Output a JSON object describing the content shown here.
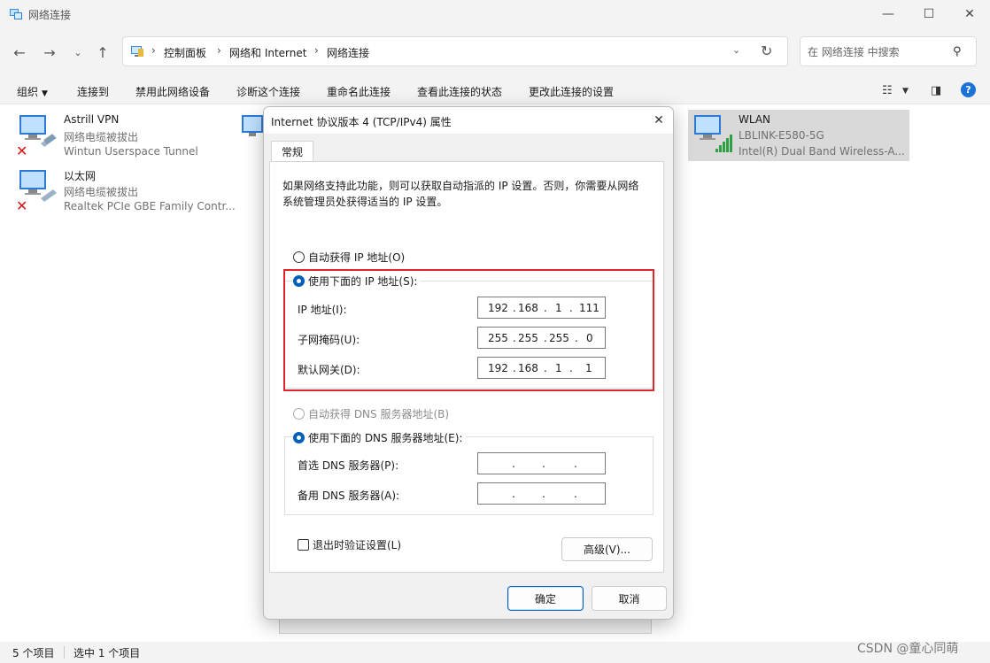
{
  "window": {
    "title": "网络连接",
    "controls": {
      "minimize": "—",
      "maximize": "☐",
      "close": "✕"
    }
  },
  "address_bar": {
    "crumbs": [
      "控制面板",
      "网络和 Internet",
      "网络连接"
    ],
    "separator": "›"
  },
  "search": {
    "placeholder": "在 网络连接 中搜索"
  },
  "command_bar": {
    "organize": "组织",
    "connect": "连接到",
    "disable": "禁用此网络设备",
    "diagnose": "诊断这个连接",
    "rename": "重命名此连接",
    "view_status": "查看此连接的状态",
    "change_settings": "更改此连接的设置",
    "help": "?"
  },
  "connections": [
    {
      "name": "Astrill VPN",
      "status": "网络电缆被拔出",
      "device": "Wintun Userspace Tunnel"
    },
    {
      "name": "以太网",
      "status": "网络电缆被拔出",
      "device": "Realtek PCIe GBE Family Contr..."
    },
    {
      "name": "WLAN",
      "status": "LBLINK-E580-5G",
      "device": "Intel(R) Dual Band Wireless-A..."
    }
  ],
  "status_bar": {
    "item_count": "5 个项目",
    "selected": "选中 1 个项目"
  },
  "watermark": "CSDN @童心同萌",
  "dialog": {
    "title": "Internet 协议版本 4 (TCP/IPv4) 属性",
    "tab": "常规",
    "description": "如果网络支持此功能，则可以获取自动指派的 IP 设置。否则，你需要从网络系统管理员处获得适当的 IP 设置。",
    "auto_ip": "自动获得 IP 地址(O)",
    "manual_ip": "使用下面的 IP 地址(S):",
    "ip_label": "IP 地址(I):",
    "ip": [
      "192",
      "168",
      "1",
      "111"
    ],
    "mask_label": "子网掩码(U):",
    "mask": [
      "255",
      "255",
      "255",
      "0"
    ],
    "gateway_label": "默认网关(D):",
    "gateway": [
      "192",
      "168",
      "1",
      "1"
    ],
    "auto_dns": "自动获得 DNS 服务器地址(B)",
    "manual_dns": "使用下面的 DNS 服务器地址(E):",
    "dns1_label": "首选 DNS 服务器(P):",
    "dns2_label": "备用 DNS 服务器(A):",
    "ip_separator": ".",
    "validate": "退出时验证设置(L)",
    "advanced": "高级(V)...",
    "ok": "确定",
    "cancel": "取消",
    "selected_ip_mode": "manual",
    "selected_dns_mode": "manual",
    "validate_checked": false
  },
  "colors": {
    "highlight_border": "#e0262a",
    "accent": "#005fb8",
    "selection_bg": "#d9d9d9"
  }
}
